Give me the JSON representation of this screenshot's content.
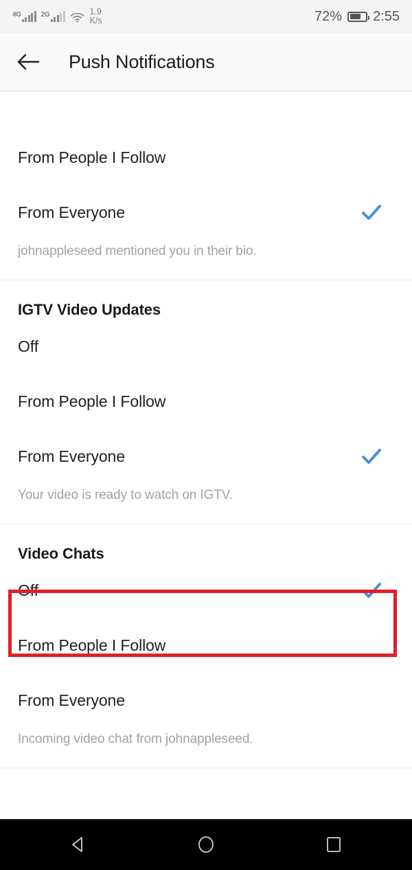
{
  "status_bar": {
    "network_primary": "4G",
    "network_secondary": "2G",
    "data_rate_value": "1.9",
    "data_rate_unit": "K/s",
    "battery_percent": "72%",
    "battery_level": 72,
    "time": "2:55",
    "icons": [
      "signal-bars-icon",
      "wifi-icon",
      "battery-icon"
    ]
  },
  "app_bar": {
    "back_icon": "arrow-left-icon",
    "title": "Push Notifications"
  },
  "accent_color": "#4a90d9",
  "annotation_color": "#e31e24",
  "sections": [
    {
      "title": "",
      "options": [
        {
          "label": "From People I Follow",
          "selected": false
        },
        {
          "label": "From Everyone",
          "selected": true
        }
      ],
      "helper": "johnappleseed mentioned you in their bio."
    },
    {
      "title": "IGTV Video Updates",
      "options": [
        {
          "label": "Off",
          "selected": false
        },
        {
          "label": "From People I Follow",
          "selected": false
        },
        {
          "label": "From Everyone",
          "selected": true
        }
      ],
      "helper": "Your video is ready to watch on IGTV."
    },
    {
      "title": "Video Chats",
      "options": [
        {
          "label": "Off",
          "selected": true
        },
        {
          "label": "From People I Follow",
          "selected": false
        },
        {
          "label": "From Everyone",
          "selected": false
        }
      ],
      "helper": "Incoming video chat from johnappleseed."
    }
  ],
  "nav_bar": {
    "back": "nav-back-triangle-icon",
    "home": "nav-home-circle-icon",
    "recents": "nav-recents-square-icon"
  }
}
